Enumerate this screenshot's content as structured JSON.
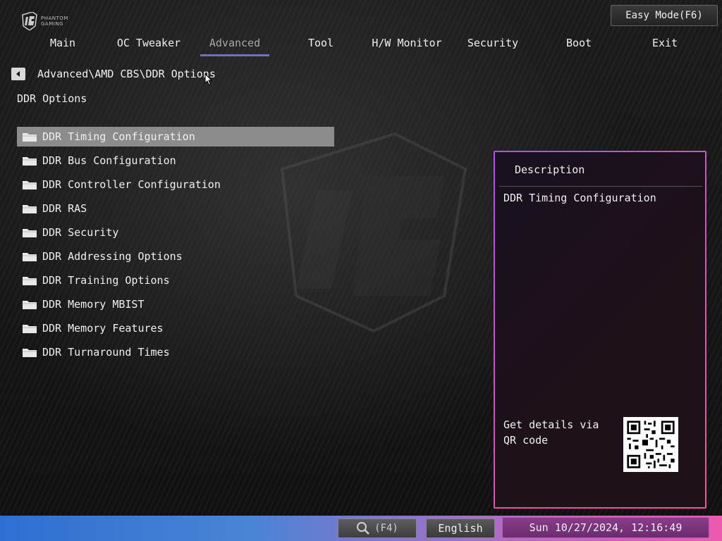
{
  "header": {
    "logo_text_line1": "PHANTOM",
    "logo_text_line2": "GAMING",
    "easy_mode_label": "Easy Mode(F6)"
  },
  "menu": {
    "items": [
      {
        "label": "Main",
        "active": false
      },
      {
        "label": "OC Tweaker",
        "active": false
      },
      {
        "label": "Advanced",
        "active": true
      },
      {
        "label": "Tool",
        "active": false
      },
      {
        "label": "H/W Monitor",
        "active": false
      },
      {
        "label": "Security",
        "active": false
      },
      {
        "label": "Boot",
        "active": false
      },
      {
        "label": "Exit",
        "active": false
      }
    ],
    "active_underline_color": "#7470b8"
  },
  "breadcrumb": "Advanced\\AMD CBS\\DDR Options",
  "page_title": "DDR Options",
  "options": {
    "items": [
      {
        "label": "DDR Timing Configuration",
        "selected": true
      },
      {
        "label": "DDR Bus Configuration",
        "selected": false
      },
      {
        "label": "DDR Controller Configuration",
        "selected": false
      },
      {
        "label": "DDR RAS",
        "selected": false
      },
      {
        "label": "DDR Security",
        "selected": false
      },
      {
        "label": "DDR Addressing Options",
        "selected": false
      },
      {
        "label": "DDR Training Options",
        "selected": false
      },
      {
        "label": "DDR Memory MBIST",
        "selected": false
      },
      {
        "label": "DDR Memory Features",
        "selected": false
      },
      {
        "label": "DDR Turnaround Times",
        "selected": false
      }
    ],
    "icon": "folder-icon",
    "selected_bg": "#8c8c8c"
  },
  "description": {
    "title": "Description",
    "text": "DDR Timing Configuration",
    "qr_text": "Get details via QR code",
    "qr_icon": "qr-code-icon"
  },
  "footer": {
    "search_label": "(F4)",
    "search_icon": "search-icon",
    "language": "English",
    "datetime": "Sun 10/27/2024, 12:16:49"
  },
  "colors": {
    "panel_border_start": "#b44cff",
    "panel_border_end": "#ff4ea0",
    "footer_gradient_start": "#2e6fd2",
    "footer_gradient_end": "#ec5ab0"
  }
}
